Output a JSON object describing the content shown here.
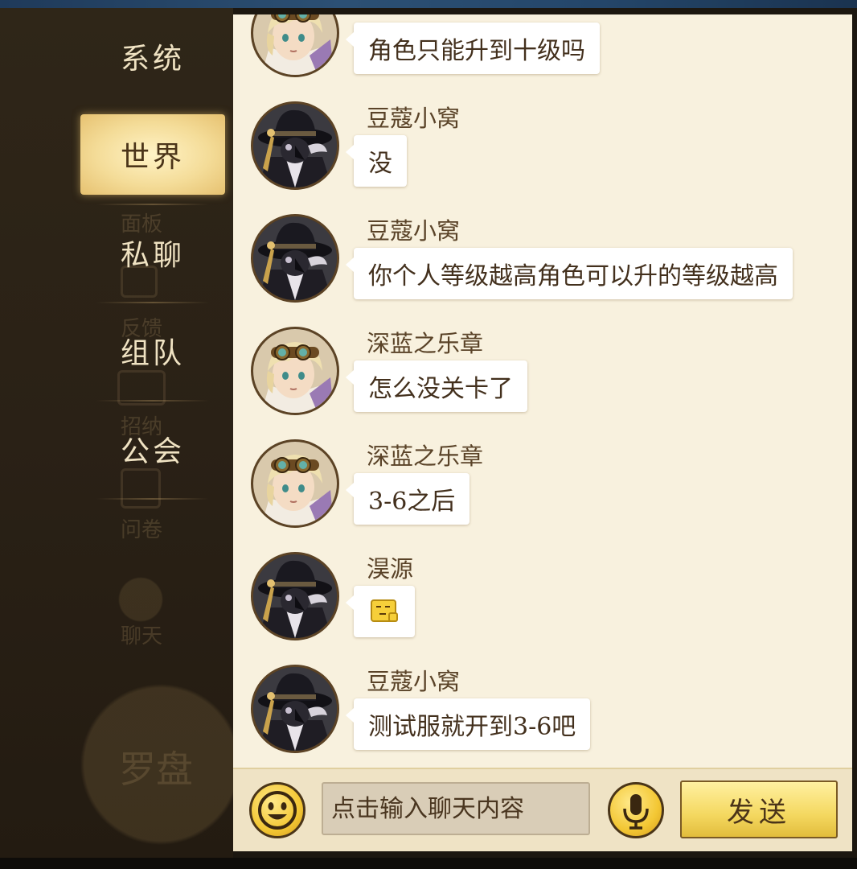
{
  "nav": {
    "items": [
      {
        "label": "系统",
        "active": false
      },
      {
        "label": "世界",
        "active": true
      },
      {
        "label": "私聊",
        "active": false
      },
      {
        "label": "组队",
        "active": false
      },
      {
        "label": "公会",
        "active": false
      }
    ]
  },
  "messages": [
    {
      "user": "",
      "text": "角色只能升到十级吗",
      "avatar": "blond-goggles-avatar"
    },
    {
      "user": "豆蔻小窝",
      "text": "没",
      "avatar": "dark-hat-avatar"
    },
    {
      "user": "豆蔻小窝",
      "text": "你个人等级越高角色可以升的等级越高",
      "avatar": "dark-hat-avatar"
    },
    {
      "user": "深蓝之乐章",
      "text": "怎么没关卡了",
      "avatar": "blond-goggles-avatar"
    },
    {
      "user": "深蓝之乐章",
      "text": "3-6之后",
      "avatar": "blond-goggles-avatar"
    },
    {
      "user": "淏源",
      "text": "",
      "emoji": "yellow-face-emoji",
      "avatar": "dark-hat-avatar"
    },
    {
      "user": "豆蔻小窝",
      "text": "测试服就开到3-6吧",
      "avatar": "dark-hat-avatar"
    }
  ],
  "input": {
    "placeholder": "点击输入聊天内容"
  },
  "buttons": {
    "emoji_icon": "smiley-icon",
    "voice_icon": "microphone-icon",
    "send_label": "发送"
  },
  "colors": {
    "accent": "#f3c734",
    "panel": "#f8f1de",
    "sidebar": "#2a2116"
  }
}
